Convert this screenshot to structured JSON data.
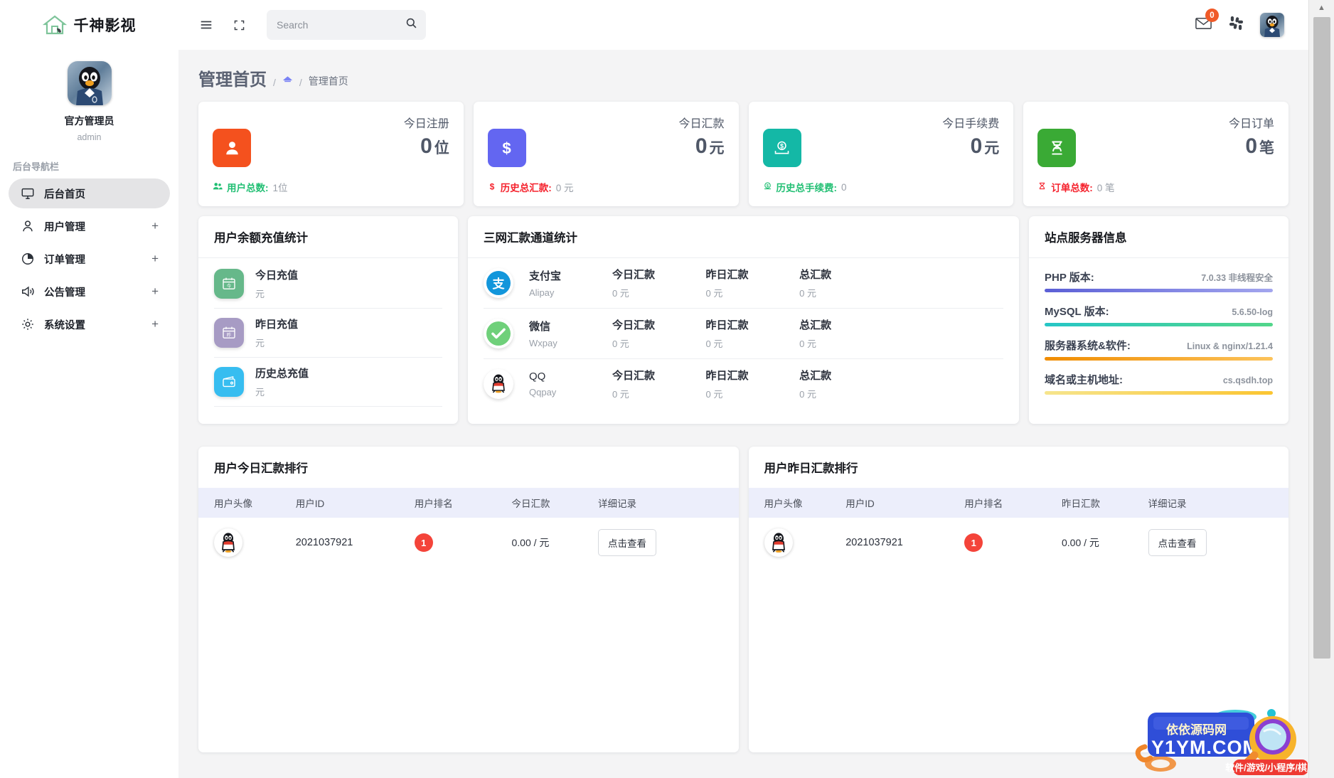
{
  "brand": {
    "name": "千神影视",
    "logo_icon": "house-icon"
  },
  "profile": {
    "avatar_icon": "qq-penguin-avatar",
    "name": "官方管理员",
    "role": "admin"
  },
  "sidebar": {
    "section_title": "后台导航栏",
    "items": [
      {
        "label": "后台首页",
        "icon": "monitor-icon",
        "active": true,
        "expand": ""
      },
      {
        "label": "用户管理",
        "icon": "user-icon",
        "active": false,
        "expand": "+"
      },
      {
        "label": "订单管理",
        "icon": "pie-chart-icon",
        "active": false,
        "expand": "+"
      },
      {
        "label": "公告管理",
        "icon": "megaphone-icon",
        "active": false,
        "expand": "+"
      },
      {
        "label": "系统设置",
        "icon": "gear-icon",
        "active": false,
        "expand": "+"
      }
    ]
  },
  "topbar": {
    "hamburger_icon": "hamburger-icon",
    "expand_icon": "fullscreen-icon",
    "search": {
      "placeholder": "Search",
      "value": "",
      "icon": "search-icon"
    },
    "mail": {
      "icon": "envelope-icon",
      "badge": "0"
    },
    "grid_icon": "slack-grid-icon",
    "avatar_icon": "qq-penguin-avatar"
  },
  "page": {
    "title": "管理首页",
    "breadcrumb": {
      "sep": "/",
      "home_icon": "home-icon",
      "current": "管理首页"
    }
  },
  "stats": [
    {
      "label": "今日注册",
      "value": "0",
      "unit": "位",
      "icon": "user-solid-icon",
      "icon_color": "#f4511e",
      "foot_icon": "users-icon",
      "foot_label": "用户总数:",
      "foot_value": "1位",
      "foot_color": "#21bf73"
    },
    {
      "label": "今日汇款",
      "value": "0",
      "unit": "元",
      "icon": "dollar-icon",
      "icon_color": "#6366f1",
      "foot_icon": "dollar-sign-icon",
      "foot_label": "历史总汇款:",
      "foot_value": "0 元",
      "foot_color": "#f5222d"
    },
    {
      "label": "今日手续费",
      "value": "0",
      "unit": "元",
      "icon": "money-in-icon",
      "icon_color": "#14b8a6",
      "foot_icon": "coin-icon",
      "foot_label": "历史总手续费:",
      "foot_value": "0",
      "foot_color": "#21bf73"
    },
    {
      "label": "今日订单",
      "value": "0",
      "unit": "笔",
      "icon": "dna-icon",
      "icon_color": "#3aaa35",
      "foot_icon": "dna-small-icon",
      "foot_label": "订单总数:",
      "foot_value": "0 笔",
      "foot_color": "#f5222d"
    }
  ],
  "recharge": {
    "title": "用户余额充值统计",
    "rows": [
      {
        "title": "今日充值",
        "unit": "元",
        "icon": "calendar-today-icon",
        "icon_color": "#66b88a"
      },
      {
        "title": "昨日充值",
        "unit": "元",
        "icon": "calendar-yesterday-icon",
        "icon_color": "#a79bc4"
      },
      {
        "title": "历史总充值",
        "unit": "元",
        "icon": "wallet-icon",
        "icon_color": "#37bdf0"
      }
    ]
  },
  "channels": {
    "title": "三网汇款通道统计",
    "columns": [
      "今日汇款",
      "昨日汇款",
      "总汇款"
    ],
    "rows": [
      {
        "name": "支付宝",
        "code": "Alipay",
        "logo": "alipay-logo",
        "today_label": "今日汇款",
        "today": "0 元",
        "yesterday_label": "昨日汇款",
        "yesterday": "0 元",
        "total_label": "总汇款",
        "total": "0 元"
      },
      {
        "name": "微信",
        "code": "Wxpay",
        "logo": "wechat-logo",
        "today_label": "今日汇款",
        "today": "0 元",
        "yesterday_label": "昨日汇款",
        "yesterday": "0 元",
        "total_label": "总汇款",
        "total": "0 元"
      },
      {
        "name": "QQ",
        "code": "Qqpay",
        "logo": "qq-logo",
        "today_label": "今日汇款",
        "today": "0 元",
        "yesterday_label": "昨日汇款",
        "yesterday": "0 元",
        "total_label": "总汇款",
        "total": "0 元"
      }
    ]
  },
  "server": {
    "title": "站点服务器信息",
    "rows": [
      {
        "key": "PHP 版本:",
        "value": "7.0.33 非线程安全",
        "bar_from": "#5b5fd6",
        "bar_to": "#a3a6ee"
      },
      {
        "key": "MySQL 版本:",
        "value": "5.6.50-log",
        "bar_from": "#26c6c6",
        "bar_to": "#52d68a"
      },
      {
        "key": "服务器系统&软件:",
        "value": "Linux & nginx/1.21.4",
        "bar_from": "#f08c00",
        "bar_to": "#fcc35b"
      },
      {
        "key": "域名或主机地址:",
        "value": "cs.qsdh.top",
        "bar_from": "#f6e58d",
        "bar_to": "#fbc531"
      }
    ]
  },
  "rank_today": {
    "title": "用户今日汇款排行",
    "columns": [
      "用户头像",
      "用户ID",
      "用户排名",
      "今日汇款",
      "详细记录"
    ],
    "rows": [
      {
        "avatar": "qq-penguin-avatar",
        "uid": "2021037921",
        "rank": "1",
        "amount": "0.00 / 元",
        "action": "点击查看"
      }
    ]
  },
  "rank_yesterday": {
    "title": "用户昨日汇款排行",
    "columns": [
      "用户头像",
      "用户ID",
      "用户排名",
      "昨日汇款",
      "详细记录"
    ],
    "rows": [
      {
        "avatar": "qq-penguin-avatar",
        "uid": "2021037921",
        "rank": "1",
        "amount": "0.00 / 元",
        "action": "点击查看"
      }
    ]
  },
  "watermark": {
    "site_cn": "依依源码网",
    "site_en": "Y1YM.COM",
    "tagline": "软件/游戏/小程序/棋牌"
  },
  "scrollbar": {
    "up_arrow": "▲"
  }
}
